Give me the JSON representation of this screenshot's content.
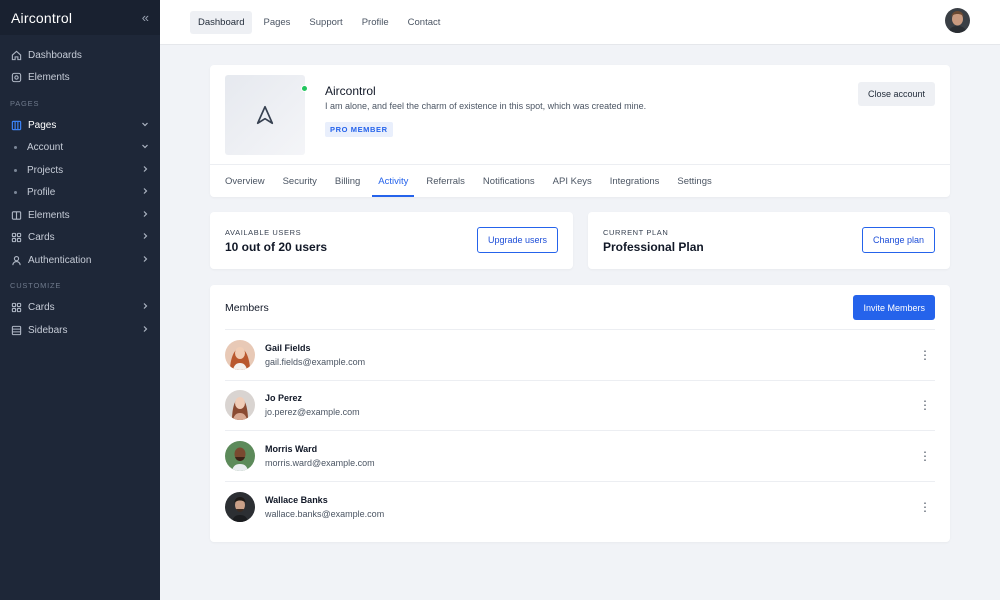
{
  "sidebar": {
    "brand": "Aircontrol",
    "collapse_icon": "«",
    "items_top": [
      {
        "label": "Dashboards",
        "icon": "home-icon"
      },
      {
        "label": "Elements",
        "icon": "settings-icon"
      }
    ],
    "section_pages": "PAGES",
    "pages_item": {
      "label": "Pages",
      "icon": "layout-icon"
    },
    "pages_sub": [
      {
        "label": "Account"
      },
      {
        "label": "Projects"
      },
      {
        "label": "Profile"
      }
    ],
    "items_pages": [
      {
        "label": "Elements",
        "icon": "columns-icon"
      },
      {
        "label": "Cards",
        "icon": "grid-icon"
      },
      {
        "label": "Authentication",
        "icon": "user-icon"
      }
    ],
    "section_customize": "CUSTOMIZE",
    "items_customize": [
      {
        "label": "Cards",
        "icon": "grid-icon"
      },
      {
        "label": "Sidebars",
        "icon": "sidebar-icon"
      }
    ]
  },
  "topbar": {
    "links": [
      "Dashboard",
      "Pages",
      "Support",
      "Profile",
      "Contact"
    ]
  },
  "profile": {
    "name": "Aircontrol",
    "description": "I am alone, and feel the charm of existence in this spot, which was created mine.",
    "badge": "PRO MEMBER",
    "close_label": "Close account",
    "tabs": [
      "Overview",
      "Security",
      "Billing",
      "Activity",
      "Referrals",
      "Notifications",
      "API Keys",
      "Integrations",
      "Settings"
    ],
    "active_tab": "Activity"
  },
  "users_stat": {
    "label": "AVAILABLE USERS",
    "value": "10 out of 20 users",
    "button": "Upgrade users"
  },
  "plan_stat": {
    "label": "CURRENT PLAN",
    "value": "Professional Plan",
    "button": "Change plan"
  },
  "members": {
    "title": "Members",
    "invite_label": "Invite Members",
    "list": [
      {
        "name": "Gail Fields",
        "email": "gail.fields@example.com"
      },
      {
        "name": "Jo Perez",
        "email": "jo.perez@example.com"
      },
      {
        "name": "Morris Ward",
        "email": "morris.ward@example.com"
      },
      {
        "name": "Wallace Banks",
        "email": "wallace.banks@example.com"
      }
    ]
  },
  "colors": {
    "accent": "#2563eb",
    "sidebar_bg": "#1e2738",
    "online": "#22c55e"
  }
}
